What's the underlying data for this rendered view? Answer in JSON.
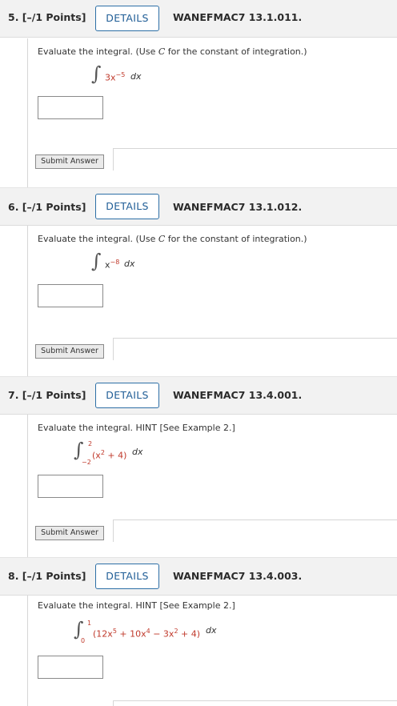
{
  "questions": [
    {
      "number": "5. [–/1 Points]",
      "details_label": "DETAILS",
      "code": "WANEFMAC7 13.1.011.",
      "prompt_before": "Evaluate the integral. (Use ",
      "prompt_var": "C",
      "prompt_after": " for the constant of integration.)",
      "integrand_coef": "3x",
      "integrand_exp": "−5",
      "differential": "dx",
      "submit_label": "Submit Answer"
    },
    {
      "number": "6. [–/1 Points]",
      "details_label": "DETAILS",
      "code": "WANEFMAC7 13.1.012.",
      "prompt_before": "Evaluate the integral. (Use ",
      "prompt_var": "C",
      "prompt_after": " for the constant of integration.)",
      "integrand_coef": "x",
      "integrand_exp": "−8",
      "differential": "dx",
      "submit_label": "Submit Answer"
    },
    {
      "number": "7. [–/1 Points]",
      "details_label": "DETAILS",
      "code": "WANEFMAC7 13.4.001.",
      "prompt": "Evaluate the integral. HINT [See Example 2.]",
      "upper": "2",
      "lower": "−2",
      "open": "(x",
      "exp1": "2",
      "rest": " + 4)",
      "differential": "dx",
      "submit_label": "Submit Answer"
    },
    {
      "number": "8. [–/1 Points]",
      "details_label": "DETAILS",
      "code": "WANEFMAC7 13.4.003.",
      "prompt": "Evaluate the integral. HINT [See Example 2.]",
      "upper": "1",
      "lower": "0",
      "t1": "(12x",
      "e1": "5",
      "t2": " + 10x",
      "e2": "4",
      "t3": " − 3x",
      "e3": "2",
      "t4": " + 4)",
      "differential": "dx"
    }
  ],
  "colors": {
    "accent": "#1f5d96",
    "math_red": "#c0392b",
    "header_bg": "#f2f2f2"
  }
}
